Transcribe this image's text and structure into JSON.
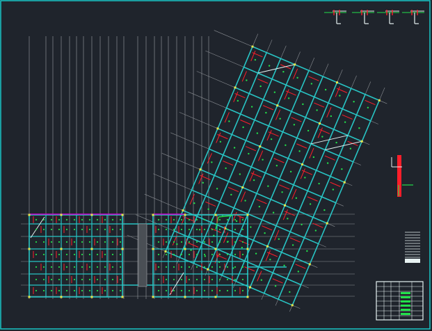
{
  "app": {
    "kind": "CAD drawing viewport"
  },
  "colors": {
    "background": "#1f242c",
    "frame": "#19c7c7",
    "beam": "#28c4c4",
    "wall": "#e7f2f2",
    "rebar_red": "#ff1e2a",
    "node_green": "#22e04a",
    "node_yellow": "#e6e64a",
    "grid_gray": "#8b8f94",
    "magenta": "#d000d0"
  },
  "icons": {
    "detail_top_right": "wall-section-detail-icon",
    "detail_right_mid": "column-detail-icon",
    "legend_block": "legend-table-icon",
    "title_block": "title-block-icon"
  }
}
